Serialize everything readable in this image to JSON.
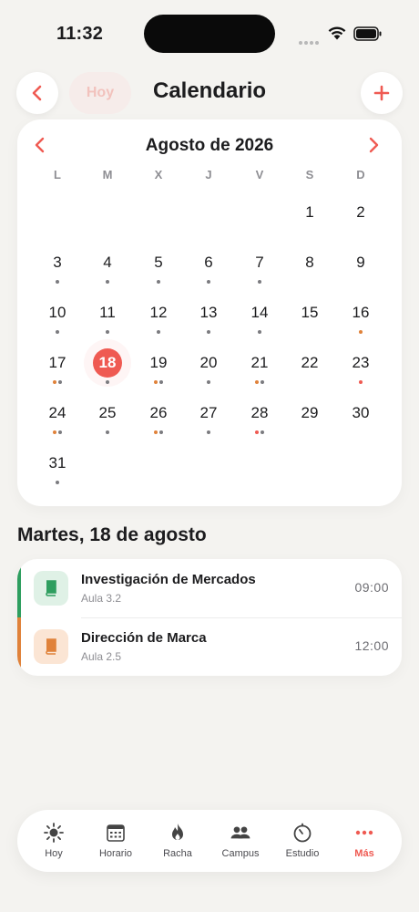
{
  "status_bar": {
    "time": "11:32"
  },
  "header": {
    "today_label": "Hoy",
    "title": "Calendario"
  },
  "calendar": {
    "month_label": "Agosto de 2026",
    "weekdays": [
      "L",
      "M",
      "X",
      "J",
      "V",
      "S",
      "D"
    ],
    "selected_day": 18,
    "dot_colors": {
      "gray": "#7b7b7f",
      "orange": "#e0823a",
      "red": "#ef5a52"
    },
    "days": [
      {
        "d": "1",
        "dots": []
      },
      {
        "d": "2",
        "dots": []
      },
      {
        "d": "3",
        "dots": [
          "gray"
        ]
      },
      {
        "d": "4",
        "dots": [
          "gray"
        ]
      },
      {
        "d": "5",
        "dots": [
          "gray"
        ]
      },
      {
        "d": "6",
        "dots": [
          "gray"
        ]
      },
      {
        "d": "7",
        "dots": [
          "gray"
        ]
      },
      {
        "d": "8",
        "dots": []
      },
      {
        "d": "9",
        "dots": []
      },
      {
        "d": "10",
        "dots": [
          "gray"
        ]
      },
      {
        "d": "11",
        "dots": [
          "gray"
        ]
      },
      {
        "d": "12",
        "dots": [
          "gray"
        ]
      },
      {
        "d": "13",
        "dots": [
          "gray"
        ]
      },
      {
        "d": "14",
        "dots": [
          "gray"
        ]
      },
      {
        "d": "15",
        "dots": []
      },
      {
        "d": "16",
        "dots": [
          "orange"
        ]
      },
      {
        "d": "17",
        "dots": [
          "orange",
          "gray"
        ]
      },
      {
        "d": "18",
        "dots": [
          "gray"
        ]
      },
      {
        "d": "19",
        "dots": [
          "orange",
          "gray"
        ]
      },
      {
        "d": "20",
        "dots": [
          "gray"
        ]
      },
      {
        "d": "21",
        "dots": [
          "orange",
          "gray"
        ]
      },
      {
        "d": "22",
        "dots": []
      },
      {
        "d": "23",
        "dots": [
          "red"
        ]
      },
      {
        "d": "24",
        "dots": [
          "orange",
          "gray"
        ]
      },
      {
        "d": "25",
        "dots": [
          "gray"
        ]
      },
      {
        "d": "26",
        "dots": [
          "orange",
          "gray"
        ]
      },
      {
        "d": "27",
        "dots": [
          "gray"
        ]
      },
      {
        "d": "28",
        "dots": [
          "red",
          "gray"
        ]
      },
      {
        "d": "29",
        "dots": []
      },
      {
        "d": "30",
        "dots": []
      },
      {
        "d": "31",
        "dots": [
          "gray"
        ]
      }
    ]
  },
  "day_section": {
    "title": "Martes, 18 de agosto"
  },
  "events": [
    {
      "name": "Investigación de Mercados",
      "room": "Aula 3.2",
      "time": "09:00",
      "color": "#2e9e5f",
      "icon_bg": "#dff1e6",
      "icon": "book-icon"
    },
    {
      "name": "Dirección de Marca",
      "room": "Aula 2.5",
      "time": "12:00",
      "color": "#e0823a",
      "icon_bg": "#fbe5d4",
      "icon": "book-icon"
    }
  ],
  "tabbar": {
    "tabs": [
      {
        "label": "Hoy",
        "icon": "sun-icon"
      },
      {
        "label": "Horario",
        "icon": "calendar-grid-icon"
      },
      {
        "label": "Racha",
        "icon": "flame-icon"
      },
      {
        "label": "Campus",
        "icon": "people-icon"
      },
      {
        "label": "Estudio",
        "icon": "timer-icon"
      },
      {
        "label": "Más",
        "icon": "more-icon",
        "active": true
      }
    ]
  },
  "colors": {
    "accent": "#ef5a52",
    "background": "#f4f3f0"
  }
}
